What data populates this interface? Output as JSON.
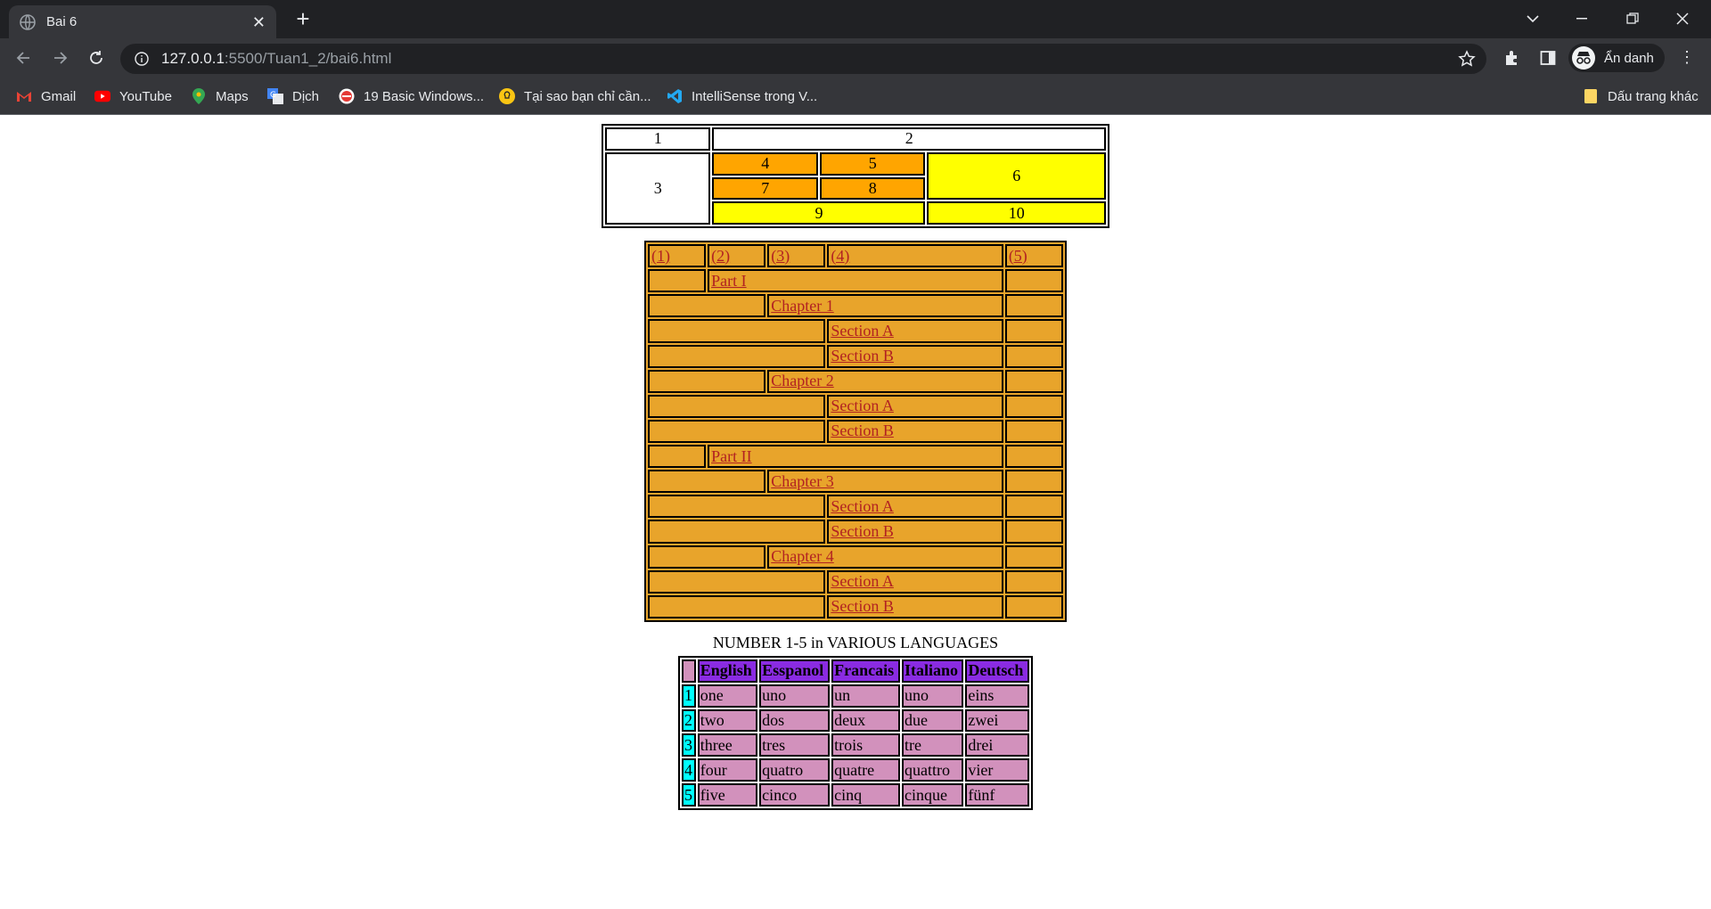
{
  "browser": {
    "tab_title": "Bai 6",
    "url_host": "127.0.0.1",
    "url_path": ":5500/Tuan1_2/bai6.html",
    "profile_label": "Ẩn danh",
    "bookmarks": [
      {
        "label": "Gmail",
        "icon": "gmail-icon"
      },
      {
        "label": "YouTube",
        "icon": "youtube-icon"
      },
      {
        "label": "Maps",
        "icon": "maps-icon"
      },
      {
        "label": "Dịch",
        "icon": "translate-icon"
      },
      {
        "label": "19 Basic Windows...",
        "icon": "site-icon"
      },
      {
        "label": "Tại sao bạn chỉ cần...",
        "icon": "bulb-icon"
      },
      {
        "label": "IntelliSense trong V...",
        "icon": "vscode-icon"
      }
    ],
    "other_bookmarks": "Dấu trang khác"
  },
  "table1": {
    "c1": "1",
    "c2": "2",
    "c3": "3",
    "c4": "4",
    "c5": "5",
    "c6": "6",
    "c7": "7",
    "c8": "8",
    "c9": "9",
    "c10": "10"
  },
  "table2": {
    "headers": [
      "(1)",
      "(2)",
      "(3)",
      "(4)",
      "(5)"
    ],
    "part1": "Part I",
    "chapter1": "Chapter 1",
    "chapter2": "Chapter 2",
    "part2": "Part II",
    "chapter3": "Chapter 3",
    "chapter4": "Chapter 4",
    "section_a": "Section A",
    "section_b": "Section B"
  },
  "table3": {
    "caption": "NUMBER 1-5 in VARIOUS LANGUAGES",
    "headers": [
      "English",
      "Esspanol",
      "Francais",
      "Italiano",
      "Deutsch"
    ],
    "rows": [
      {
        "n": "1",
        "cells": [
          "one",
          "uno",
          "un",
          "uno",
          "eins"
        ]
      },
      {
        "n": "2",
        "cells": [
          "two",
          "dos",
          "deux",
          "due",
          "zwei"
        ]
      },
      {
        "n": "3",
        "cells": [
          "three",
          "tres",
          "trois",
          "tre",
          "drei"
        ]
      },
      {
        "n": "4",
        "cells": [
          "four",
          "quatro",
          "quatre",
          "quattro",
          "vier"
        ]
      },
      {
        "n": "5",
        "cells": [
          "five",
          "cinco",
          "cinq",
          "cinque",
          "fünf"
        ]
      }
    ]
  }
}
